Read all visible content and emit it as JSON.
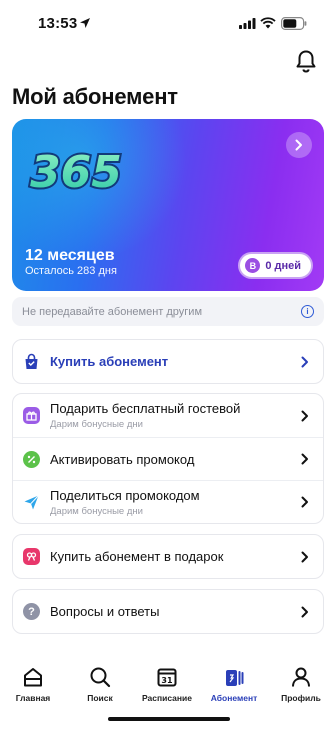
{
  "status": {
    "time": "13:53"
  },
  "header": {
    "title": "Мой абонемент"
  },
  "card": {
    "logo_text": "365",
    "plan": "12 месяцев",
    "remaining": "Осталось 283 дня",
    "badge_letter": "В",
    "badge_text": "0 дней",
    "colors": {
      "start": "#1d8fe8",
      "end": "#a23af5"
    }
  },
  "notice": {
    "text": "Не передавайте абонемент другим"
  },
  "actions": {
    "buy": {
      "label": "Купить абонемент",
      "icon": "bag-icon"
    },
    "gift_guest": {
      "label": "Подарить бесплатный гостевой",
      "sub": "Дарим бонусные дни",
      "icon": "gift-icon"
    },
    "promo": {
      "label": "Активировать промокод",
      "icon": "percent-icon"
    },
    "share_promo": {
      "label": "Поделиться промокодом",
      "sub": "Дарим бонусные дни",
      "icon": "send-icon"
    },
    "gift_sub": {
      "label": "Купить абонемент в подарок",
      "icon": "gift-box-icon"
    },
    "faq": {
      "label": "Вопросы и ответы",
      "icon": "question-icon"
    }
  },
  "tabs": [
    {
      "label": "Главная",
      "icon": "home-icon"
    },
    {
      "label": "Поиск",
      "icon": "search-icon"
    },
    {
      "label": "Расписание",
      "icon": "calendar-icon",
      "day": "31"
    },
    {
      "label": "Абонемент",
      "icon": "card-icon",
      "active": true
    },
    {
      "label": "Профиль",
      "icon": "profile-icon"
    }
  ]
}
